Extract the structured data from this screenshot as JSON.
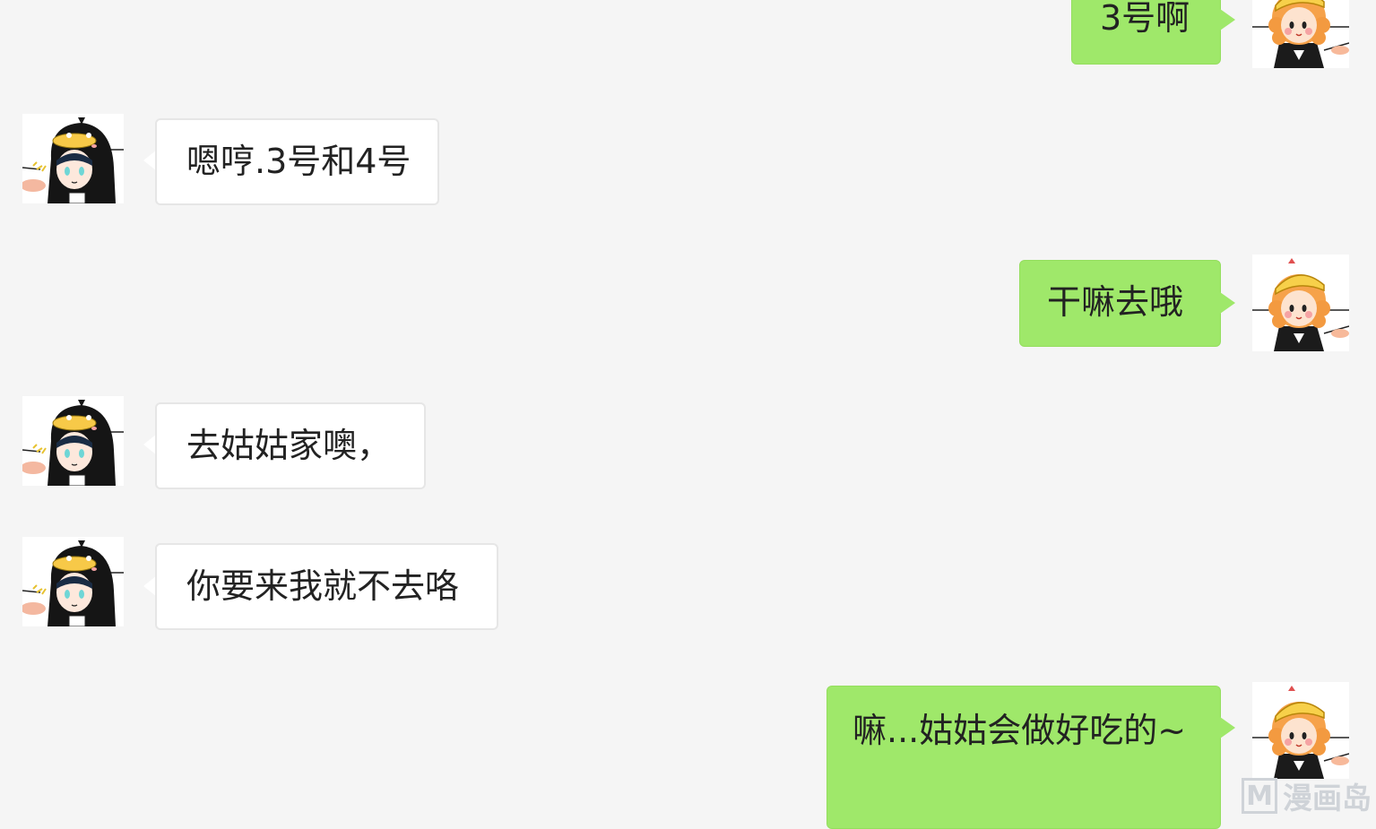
{
  "chat": {
    "messages": [
      {
        "sender": "self",
        "text": "3号啊"
      },
      {
        "sender": "other",
        "text": "嗯哼.3号和4号"
      },
      {
        "sender": "self",
        "text": "干嘛去哦"
      },
      {
        "sender": "other",
        "text": "去姑姑家噢，"
      },
      {
        "sender": "other",
        "text": "你要来我就不去咯"
      },
      {
        "sender": "self",
        "text": "嘛...姑姑会做好吃的~"
      }
    ]
  },
  "watermark": {
    "logo": "M",
    "text": "漫画岛"
  },
  "colors": {
    "background": "#f5f5f5",
    "self_bubble": "#9fe86a",
    "other_bubble": "#ffffff"
  },
  "icons": {
    "self_avatar": "orange-hair-girl-avatar-icon",
    "other_avatar": "penguin-hood-girl-avatar-icon"
  }
}
